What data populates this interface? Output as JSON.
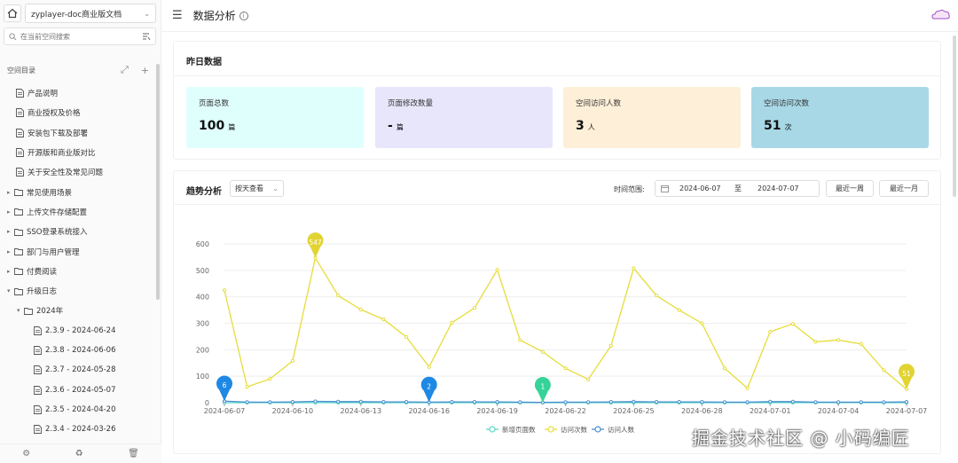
{
  "sidebar": {
    "space_name": "zyplayer-doc商业版文档",
    "search_placeholder": "在当前空间搜索",
    "directory_title": "空间目录",
    "items": [
      {
        "label": "产品说明",
        "type": "doc",
        "level": 0
      },
      {
        "label": "商业授权及价格",
        "type": "doc",
        "level": 0
      },
      {
        "label": "安装包下载及部署",
        "type": "doc",
        "level": 0
      },
      {
        "label": "开源版和商业版对比",
        "type": "doc",
        "level": 0
      },
      {
        "label": "关于安全性及常见问题",
        "type": "doc",
        "level": 0
      },
      {
        "label": "常见使用场景",
        "type": "folder",
        "level": 0,
        "expanded": false
      },
      {
        "label": "上传文件存储配置",
        "type": "folder",
        "level": 0,
        "expanded": false
      },
      {
        "label": "SSO登录系统接入",
        "type": "folder",
        "level": 0,
        "expanded": false
      },
      {
        "label": "部门与用户管理",
        "type": "folder",
        "level": 0,
        "expanded": false
      },
      {
        "label": "付费阅读",
        "type": "folder",
        "level": 0,
        "expanded": false
      },
      {
        "label": "升级日志",
        "type": "folder",
        "level": 0,
        "expanded": true
      },
      {
        "label": "2024年",
        "type": "folder",
        "level": 1,
        "expanded": true
      },
      {
        "label": "2.3.9 - 2024-06-24",
        "type": "doc",
        "level": 2
      },
      {
        "label": "2.3.8 - 2024-06-06",
        "type": "doc",
        "level": 2
      },
      {
        "label": "2.3.7 - 2024-05-28",
        "type": "doc",
        "level": 2
      },
      {
        "label": "2.3.6 - 2024-05-07",
        "type": "doc",
        "level": 2
      },
      {
        "label": "2.3.5 - 2024-04-20",
        "type": "doc",
        "level": 2
      },
      {
        "label": "2.3.4 - 2024-03-26",
        "type": "doc",
        "level": 2
      }
    ]
  },
  "header": {
    "title": "数据分析"
  },
  "yesterday": {
    "title": "昨日数据",
    "stats": [
      {
        "label": "页面总数",
        "value": "100",
        "unit": "篇",
        "color": "#dffffd"
      },
      {
        "label": "页面修改数量",
        "value": "-",
        "unit": "篇",
        "color": "#e8e6fb"
      },
      {
        "label": "空间访问人数",
        "value": "3",
        "unit": "人",
        "color": "#fdefd8"
      },
      {
        "label": "空间访问次数",
        "value": "51",
        "unit": "次",
        "color": "#a8d8e6"
      }
    ]
  },
  "trend": {
    "title": "趋势分析",
    "mode": "按天查看",
    "range_label": "时间范围:",
    "start_date": "2024-06-07",
    "range_sep": "至",
    "end_date": "2024-07-07",
    "btn_week": "最近一周",
    "btn_month": "最近一月"
  },
  "chart_data": {
    "type": "line",
    "x": [
      "2024-06-07",
      "2024-06-08",
      "2024-06-09",
      "2024-06-10",
      "2024-06-11",
      "2024-06-12",
      "2024-06-13",
      "2024-06-14",
      "2024-06-15",
      "2024-06-16",
      "2024-06-17",
      "2024-06-18",
      "2024-06-19",
      "2024-06-20",
      "2024-06-21",
      "2024-06-22",
      "2024-06-23",
      "2024-06-24",
      "2024-06-25",
      "2024-06-26",
      "2024-06-27",
      "2024-06-28",
      "2024-06-29",
      "2024-06-30",
      "2024-07-01",
      "2024-07-02",
      "2024-07-03",
      "2024-07-04",
      "2024-07-05",
      "2024-07-06",
      "2024-07-07"
    ],
    "x_tick_labels": [
      "2024-06-07",
      "2024-06-10",
      "2024-06-13",
      "2024-06-16",
      "2024-06-19",
      "2024-06-22",
      "2024-06-25",
      "2024-06-28",
      "2024-07-01",
      "2024-07-04",
      "2024-07-07"
    ],
    "ylim": [
      0,
      600
    ],
    "y_ticks": [
      0,
      100,
      200,
      300,
      400,
      500,
      600
    ],
    "grid": true,
    "legend_position": "bottom",
    "series": [
      {
        "name": "新增页面数",
        "color": "#5ad8c6",
        "values": [
          0,
          0,
          0,
          0,
          0,
          0,
          0,
          0,
          0,
          0,
          0,
          0,
          0,
          0,
          0,
          0,
          0,
          0,
          0,
          0,
          0,
          0,
          0,
          0,
          0,
          0,
          0,
          0,
          0,
          0,
          0
        ]
      },
      {
        "name": "访问次数",
        "color": "#e6dd3a",
        "values": [
          425,
          60,
          90,
          158,
          547,
          405,
          352,
          315,
          248,
          135,
          302,
          358,
          502,
          237,
          192,
          130,
          88,
          215,
          508,
          405,
          350,
          300,
          130,
          55,
          268,
          298,
          230,
          237,
          222,
          123,
          51
        ]
      },
      {
        "name": "访问人数",
        "color": "#4a8fd1",
        "values": [
          6,
          2,
          2,
          3,
          5,
          4,
          4,
          3,
          3,
          2,
          3,
          3,
          3,
          2,
          1,
          2,
          2,
          3,
          4,
          3,
          3,
          3,
          2,
          2,
          4,
          4,
          2,
          2,
          2,
          2,
          3
        ]
      }
    ],
    "markers": [
      {
        "label": "6",
        "x_index": 0,
        "value": 6,
        "color": "#1e88e5"
      },
      {
        "label": "547",
        "x_index": 4,
        "value": 547,
        "color": "#e1d432"
      },
      {
        "label": "2",
        "x_index": 9,
        "value": 2,
        "color": "#1e88e5"
      },
      {
        "label": "1",
        "x_index": 14,
        "value": 1,
        "color": "#36d399"
      },
      {
        "label": "51",
        "x_index": 30,
        "value": 51,
        "color": "#e1d432"
      }
    ]
  },
  "watermark": "掘金技术社区 @ 小码编匠"
}
